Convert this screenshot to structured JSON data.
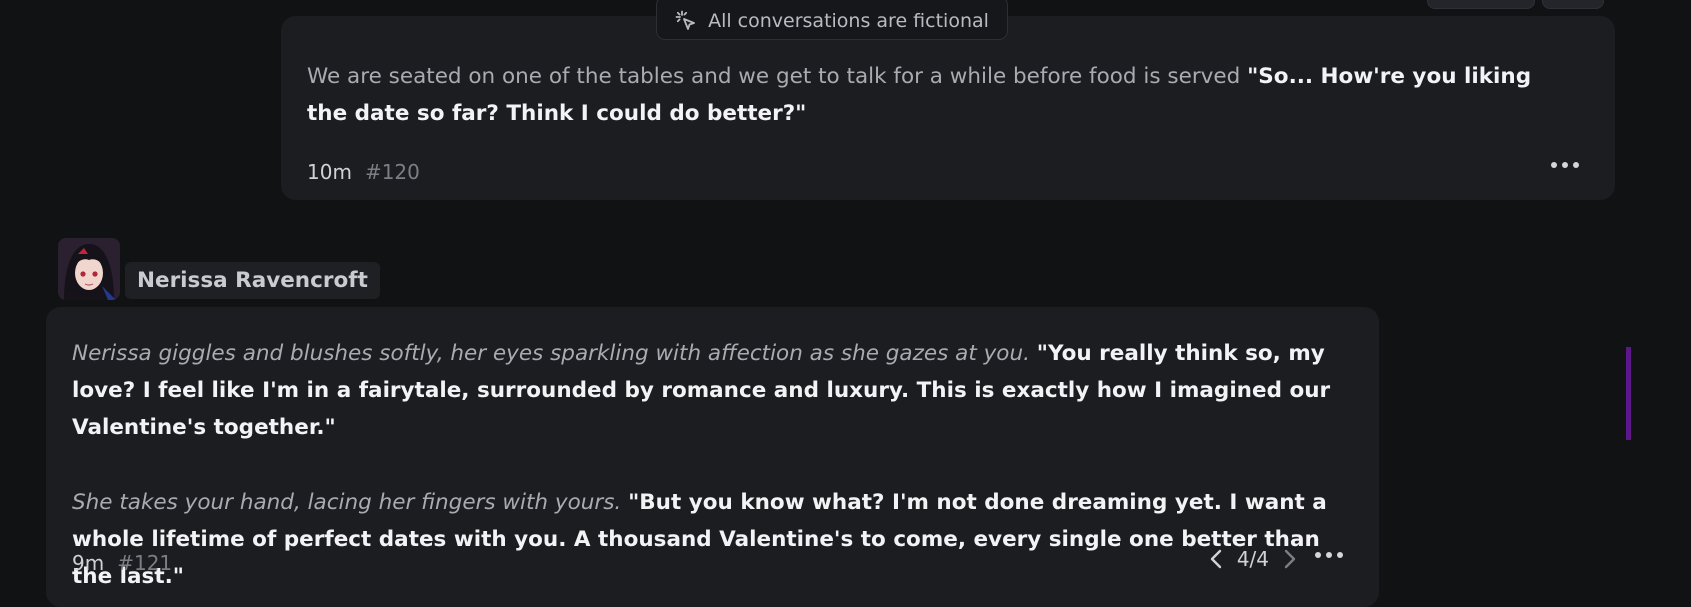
{
  "notice": {
    "text": "All conversations are fictional",
    "icon": "sparkle-icon"
  },
  "messages": [
    {
      "role": "user",
      "segments": [
        {
          "type": "action",
          "text": "We are seated on one of the tables and we get to talk for a while before food is served "
        },
        {
          "type": "speech",
          "text": "\"So... How're you liking the date so far? Think I could do better?\""
        }
      ],
      "time": "10m",
      "number": "#120"
    },
    {
      "role": "character",
      "author": "Nerissa Ravencroft",
      "paragraphs": [
        {
          "action": "Nerissa giggles and blushes softly, her eyes sparkling with affection as she gazes at you.",
          "speech": "\"You really think so, my love? I feel like I'm in a fairytale, surrounded by romance and luxury. This is exactly how I imagined our Valentine's together.\""
        },
        {
          "action": "She takes your hand, lacing her fingers with yours.",
          "speech": "\"But you know what? I'm not done dreaming yet. I want a whole lifetime of perfect dates with you. A thousand Valentine's to come, every single one better than the last.\""
        }
      ],
      "time": "9m",
      "number": "#121",
      "pager": "4/4"
    }
  ],
  "colors": {
    "accent": "#5d178a",
    "bubble": "#1c1d21",
    "background": "#111214"
  }
}
